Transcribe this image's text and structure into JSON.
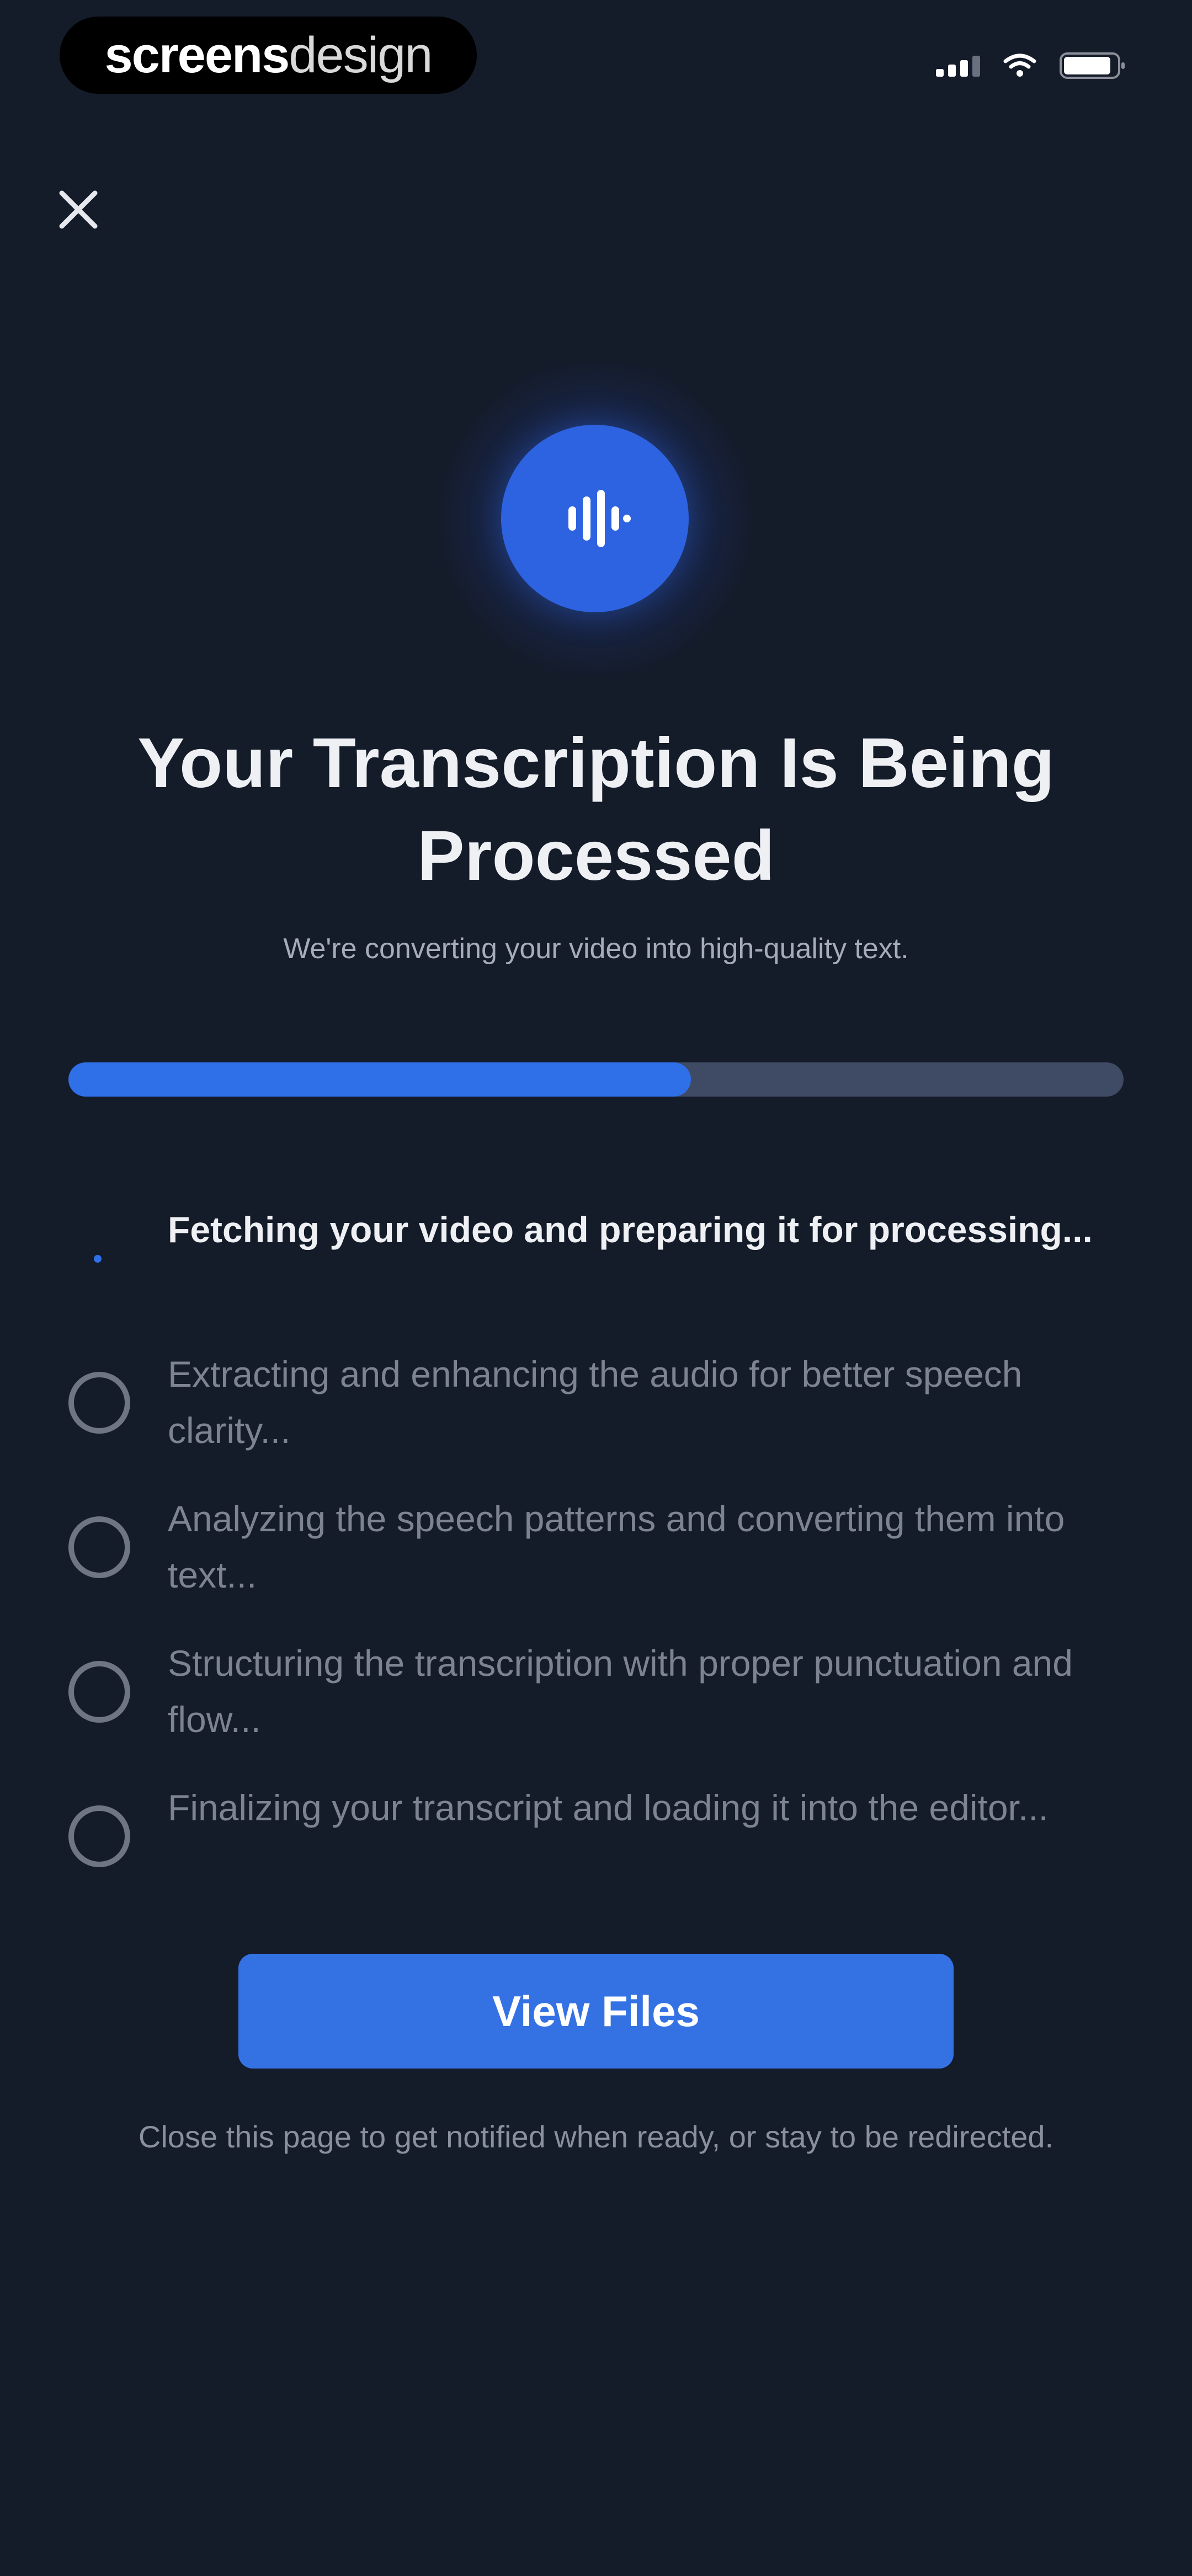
{
  "status_bar": {
    "brand_bold": "screens",
    "brand_light": "design",
    "icons": [
      "signal-icon",
      "wifi-icon",
      "battery-icon"
    ]
  },
  "header": {
    "close_icon": "close-icon"
  },
  "hero": {
    "icon": "audio-waveform-icon",
    "color": "#2d63e0"
  },
  "title": "Your Transcription Is Being Processed",
  "subtitle": "We're converting your video into high-quality text.",
  "progress": {
    "fraction": 0.59,
    "fill_color": "#2f6fe8",
    "track_color": "#3f4b64"
  },
  "steps": [
    {
      "label": "Fetching your video and preparing it for processing...",
      "state": "active"
    },
    {
      "label": "Extracting and enhancing the audio for better speech clarity...",
      "state": "pending"
    },
    {
      "label": "Analyzing the speech patterns and converting them into text...",
      "state": "pending"
    },
    {
      "label": "Structuring the transcription with proper punctuation and flow...",
      "state": "pending"
    },
    {
      "label": "Finalizing your transcript and loading it into the editor...",
      "state": "pending"
    }
  ],
  "actions": {
    "view_files_label": "View Files"
  },
  "footnote": "Close this page to get notified when ready, or stay to be redirected.",
  "colors": {
    "background": "#141b29",
    "accent": "#3472e4",
    "muted_text": "#7d8391"
  }
}
